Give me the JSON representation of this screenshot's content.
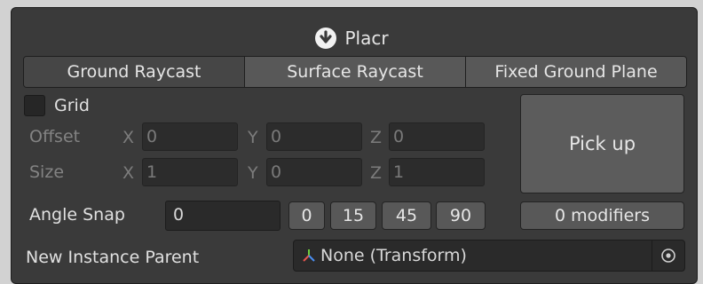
{
  "window": {
    "title": "Placr",
    "logo_icon": "placr-logo-icon"
  },
  "tabs": [
    {
      "label": "Ground Raycast",
      "active": true
    },
    {
      "label": "Surface Raycast",
      "active": false
    },
    {
      "label": "Fixed Ground Plane",
      "active": false
    }
  ],
  "grid": {
    "label": "Grid",
    "checked": false,
    "offset": {
      "label": "Offset",
      "x_axis": "X",
      "y_axis": "Y",
      "z_axis": "Z",
      "x": "0",
      "y": "0",
      "z": "0"
    },
    "size": {
      "label": "Size",
      "x_axis": "X",
      "y_axis": "Y",
      "z_axis": "Z",
      "x": "1",
      "y": "0",
      "z": "1"
    }
  },
  "pick_up": {
    "label": "Pick up"
  },
  "angle_snap": {
    "label": "Angle Snap",
    "value": "0",
    "presets": [
      "0",
      "15",
      "45",
      "90"
    ]
  },
  "modifiers": {
    "label": "0 modifiers"
  },
  "parent": {
    "label": "New Instance Parent",
    "value": "None (Transform)",
    "icon": "transform-icon",
    "picker_icon": "object-picker-icon"
  },
  "colors": {
    "panel": "#3a3a3a",
    "tab_active": "#464646",
    "tab": "#585858",
    "field": "#2c2c2c"
  }
}
